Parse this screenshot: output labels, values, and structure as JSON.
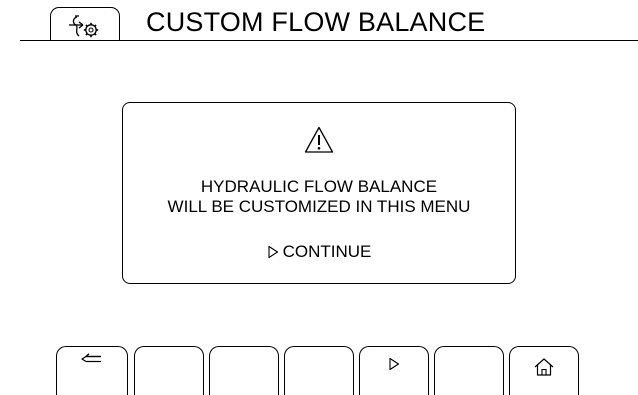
{
  "header": {
    "title": "CUSTOM FLOW BALANCE",
    "icon": "hydraulic-valve-settings-icon"
  },
  "dialog": {
    "icon": "warning-triangle-icon",
    "message_line1": "HYDRAULIC FLOW BALANCE",
    "message_line2": "WILL BE CUSTOMIZED IN THIS MENU",
    "continue_label": "CONTINUE",
    "continue_icon": "play-triangle-icon"
  },
  "softkeys": [
    {
      "icon": "back-arrow-icon",
      "label": ""
    },
    {
      "icon": "",
      "label": ""
    },
    {
      "icon": "",
      "label": ""
    },
    {
      "icon": "",
      "label": ""
    },
    {
      "icon": "play-triangle-icon",
      "label": ""
    },
    {
      "icon": "",
      "label": ""
    },
    {
      "icon": "home-icon",
      "label": ""
    }
  ],
  "colors": {
    "background": "#ffffff",
    "foreground": "#000000"
  }
}
